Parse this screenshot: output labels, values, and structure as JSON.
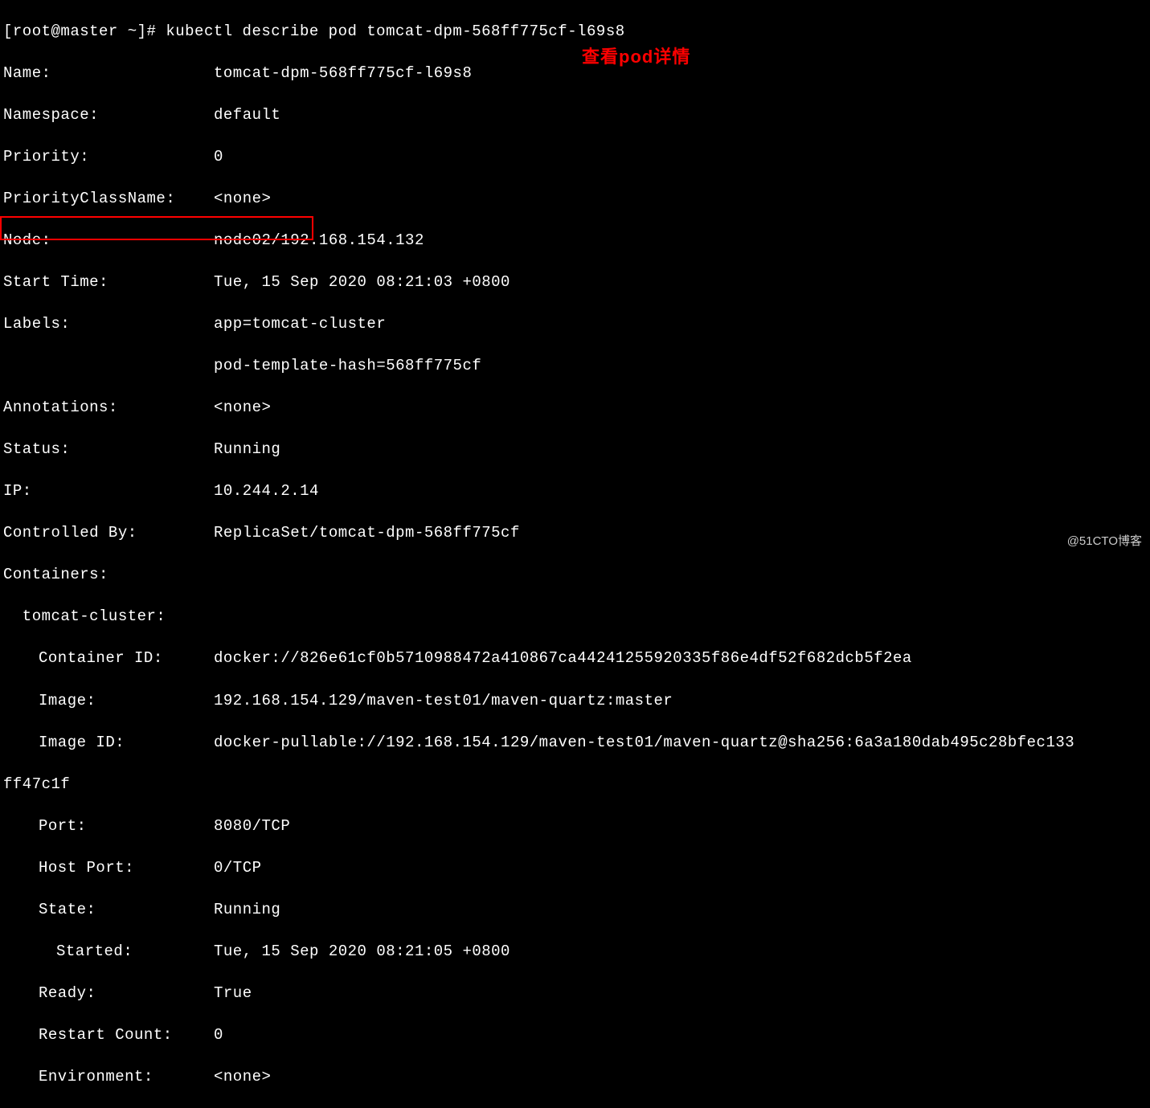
{
  "prompt": "[root@master ~]# kubectl describe pod tomcat-dpm-568ff775cf-l69s8",
  "fields": {
    "name_key": "Name:",
    "name_val": "tomcat-dpm-568ff775cf-l69s8",
    "namespace_key": "Namespace:",
    "namespace_val": "default",
    "priority_key": "Priority:",
    "priority_val": "0",
    "priorityclass_key": "PriorityClassName:",
    "priorityclass_val": "<none>",
    "node_key": "Node:",
    "node_val": "node02/192.168.154.132",
    "starttime_key": "Start Time:",
    "starttime_val": "Tue, 15 Sep 2020 08:21:03 +0800",
    "labels_key": "Labels:",
    "labels_val1": "app=tomcat-cluster",
    "labels_val2": "pod-template-hash=568ff775cf",
    "annotations_key": "Annotations:",
    "annotations_val": "<none>",
    "status_key": "Status:",
    "status_val": "Running",
    "ip_key": "IP:",
    "ip_val": "10.244.2.14",
    "controlledby_key": "Controlled By:",
    "controlledby_val": "ReplicaSet/tomcat-dpm-568ff775cf",
    "containers_key": "Containers:",
    "container_name": "  tomcat-cluster:",
    "containerid_key": "Container ID:",
    "containerid_val": "docker://826e61cf0b5710988472a410867ca44241255920335f86e4df52f682dcb5f2ea",
    "image_key": "Image:",
    "image_val": "192.168.154.129/maven-test01/maven-quartz:master",
    "imageid_key": "Image ID:",
    "imageid_val": "docker-pullable://192.168.154.129/maven-test01/maven-quartz@sha256:6a3a180dab495c28bfec133",
    "imageid_wrap": "ff47c1f",
    "port_key": "Port:",
    "port_val": "8080/TCP",
    "hostport_key": "Host Port:",
    "hostport_val": "0/TCP",
    "state_key": "State:",
    "state_val": "Running",
    "started_key": "Started:",
    "started_val": "Tue, 15 Sep 2020 08:21:05 +0800",
    "ready_key": "Ready:",
    "ready_val": "True",
    "restartcount_key": "Restart Count:",
    "restartcount_val": "0",
    "environment_key": "Environment:",
    "environment_val": "<none>"
  },
  "annotation_text": "查看pod详情",
  "watermark_text": "@51CTO博客"
}
